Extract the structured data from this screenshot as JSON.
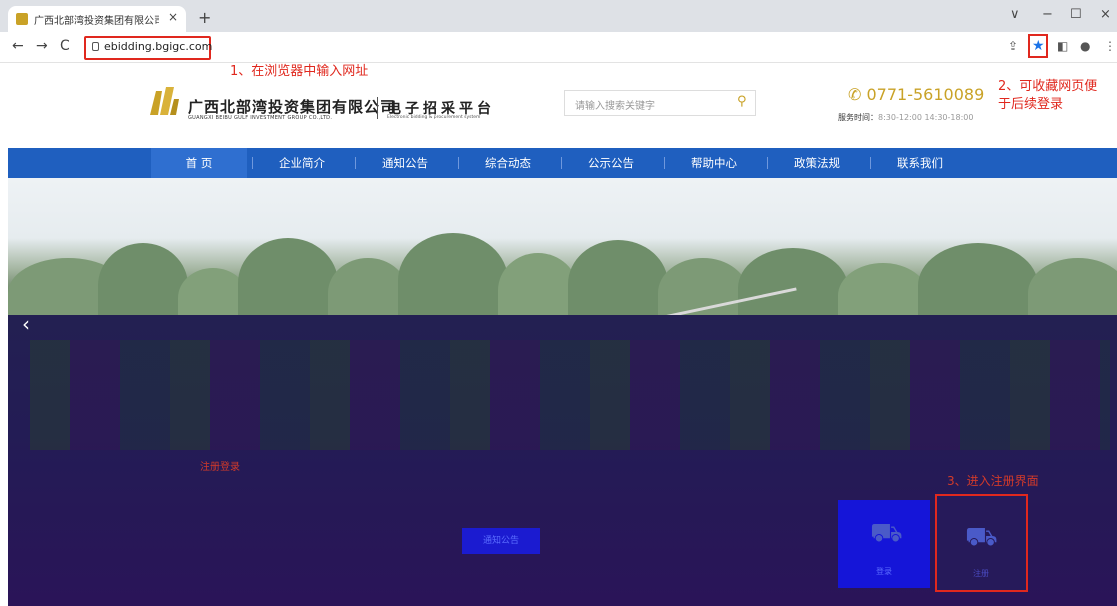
{
  "browser": {
    "tab_title": "广西北部湾投资集团有限公司-电",
    "tab_close": "×",
    "new_tab": "+",
    "url": "ebidding.bgigc.com",
    "nav_back": "←",
    "nav_forward": "→",
    "nav_reload": "C",
    "window_controls": [
      "∨",
      "−",
      "☐",
      "×"
    ]
  },
  "annotations": {
    "step1": "1、在浏览器中输入网址",
    "step2_line1": "2、可收藏网页便",
    "step2_line2": "于后续登录",
    "step3": "3、进入注册界面"
  },
  "header": {
    "company_cn": "广西北部湾投资集团有限公司",
    "company_en": "GUANGXI BEIBU GULF INVESTMENT GROUP CO.,LTD.",
    "platform_cn": "电子招采平台",
    "platform_en": "Electronic bidding & procurement system",
    "search_placeholder": "请输入搜索关键字",
    "phone": "0771-5610089",
    "service_label": "服务时间：",
    "service_hours": "8:30-12:00  14:30-18:00"
  },
  "nav": {
    "items": [
      "首 页",
      "企业简介",
      "通知公告",
      "综合动态",
      "公示公告",
      "帮助中心",
      "政策法规",
      "联系我们"
    ],
    "active_index": 0
  },
  "lower": {
    "section_title": "注册登录",
    "notice_button": "通知公告",
    "login_label": "登录",
    "register_label": "注册"
  },
  "colors": {
    "brand_gold": "#c9a227",
    "nav_blue": "#1f5fbf",
    "annotation_red": "#e0281e"
  }
}
